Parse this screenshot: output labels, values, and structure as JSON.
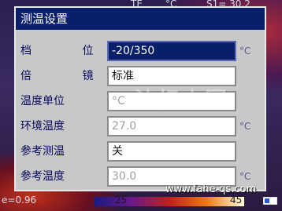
{
  "status": {
    "top_left": "TE",
    "top_unit": "°C",
    "top_right": "S1= 30.2",
    "emissivity": "e=0.96",
    "scale_min": "25",
    "scale_max": "45",
    "website": "www.fahe-qs.com"
  },
  "dialog": {
    "title": "测温设置",
    "rows": [
      {
        "label": "档 位",
        "value": "-20/350",
        "unit": "°C",
        "state": "selected"
      },
      {
        "label": "倍 镜",
        "value": "标准",
        "unit": "",
        "state": "normal"
      },
      {
        "label": "温度单位",
        "value": "°C",
        "unit": "",
        "state": "disabled"
      },
      {
        "label": "环境温度",
        "value": "27.0",
        "unit": "°C",
        "state": "disabled"
      },
      {
        "label": "参考测温",
        "value": "关",
        "unit": "",
        "state": "normal"
      },
      {
        "label": "参考温度",
        "value": "30.0",
        "unit": "°C",
        "state": "disabled"
      }
    ]
  },
  "watermark": "法标中国",
  "colors": {
    "title_bg": "#0a1f6a",
    "dialog_bg": "#c8c8c8",
    "label": "#0a0a60"
  }
}
